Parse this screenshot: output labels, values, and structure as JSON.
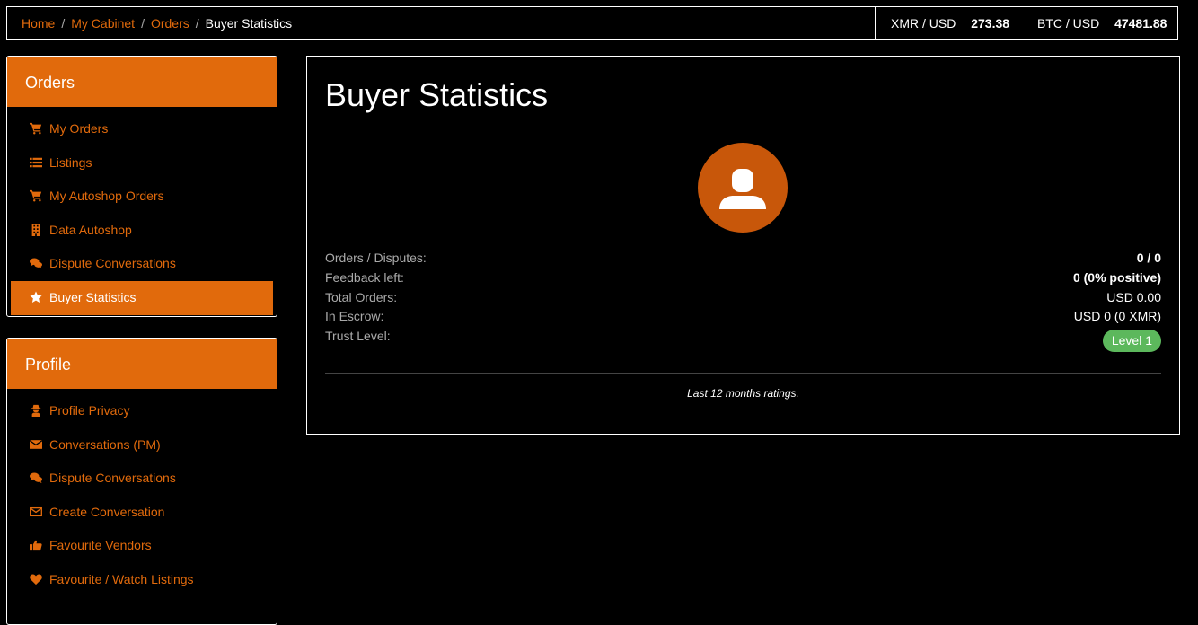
{
  "breadcrumb": {
    "items": [
      "Home",
      "My Cabinet",
      "Orders"
    ],
    "separator": "/",
    "current": "Buyer Statistics"
  },
  "rates": {
    "xmr_label": "XMR / USD",
    "xmr_value": "273.38",
    "btc_label": "BTC / USD",
    "btc_value": "47481.88"
  },
  "orders_panel": {
    "title": "Orders",
    "items": [
      {
        "label": "My Orders",
        "icon": "cart-icon"
      },
      {
        "label": "Listings",
        "icon": "list-icon"
      },
      {
        "label": "My Autoshop Orders",
        "icon": "cart-icon"
      },
      {
        "label": "Data Autoshop",
        "icon": "building-icon"
      },
      {
        "label": "Dispute Conversations",
        "icon": "comments-icon"
      },
      {
        "label": "Buyer Statistics",
        "icon": "star-icon",
        "active": true
      }
    ]
  },
  "profile_panel": {
    "title": "Profile",
    "items": [
      {
        "label": "Profile Privacy",
        "icon": "user-secret-icon"
      },
      {
        "label": "Conversations (PM)",
        "icon": "envelope-icon"
      },
      {
        "label": "Dispute Conversations",
        "icon": "comments-icon"
      },
      {
        "label": "Create Conversation",
        "icon": "envelope-outline-icon"
      },
      {
        "label": "Favourite Vendors",
        "icon": "thumbs-up-icon"
      },
      {
        "label": "Favourite / Watch Listings",
        "icon": "heart-icon"
      }
    ]
  },
  "main": {
    "title": "Buyer Statistics",
    "avatar_icon": "user-avatar-icon",
    "stats": [
      {
        "key": "Orders / Disputes:",
        "value": "0 / 0"
      },
      {
        "key": "Feedback left:",
        "value": "0 (0% positive)"
      },
      {
        "key": "Total Orders:",
        "value": "USD 0.00"
      },
      {
        "key": "In Escrow:",
        "value": "USD 0 (0 XMR)"
      },
      {
        "key": "Trust Level:",
        "value": "Level 1"
      }
    ],
    "footnote": "Last 12 months ratings."
  },
  "colors": {
    "accent": "#e16a0c",
    "avatar_bg": "#c8570a",
    "badge": "#5cb85c",
    "background": "#000000"
  }
}
